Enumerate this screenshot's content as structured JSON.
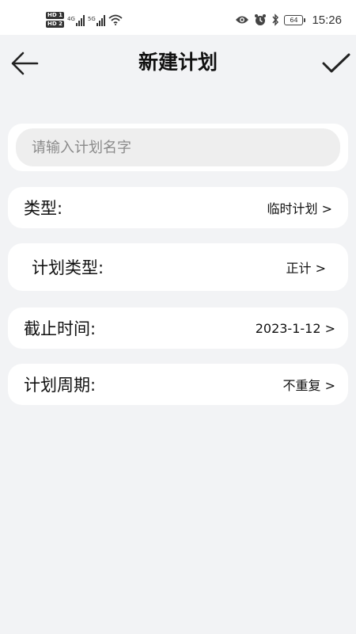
{
  "status_bar": {
    "sim1_label": "HD 1",
    "sim2_label": "HD 2",
    "net1": "4G",
    "net2": "5G",
    "battery": "64",
    "time": "15:26",
    "icons": [
      "eye-icon",
      "alarm-icon",
      "bluetooth-icon",
      "wifi-icon",
      "signal-icon"
    ]
  },
  "header": {
    "title": "新建计划",
    "back_icon": "arrow-left-icon",
    "confirm_icon": "checkmark-icon"
  },
  "form": {
    "name_input": {
      "placeholder": "请输入计划名字",
      "value": ""
    },
    "type": {
      "label": "类型:",
      "value": "临时计划 >"
    },
    "plan_type": {
      "label": "计划类型:",
      "value": "正计 >"
    },
    "deadline": {
      "label": "截止时间:",
      "value": "2023-1-12 >"
    },
    "cycle": {
      "label": "计划周期:",
      "value": "不重复 >"
    }
  },
  "colors": {
    "background": "#f2f3f5",
    "card": "#ffffff",
    "input_bg": "#eeeeee",
    "text": "#111111",
    "placeholder": "#8a8a8a"
  }
}
